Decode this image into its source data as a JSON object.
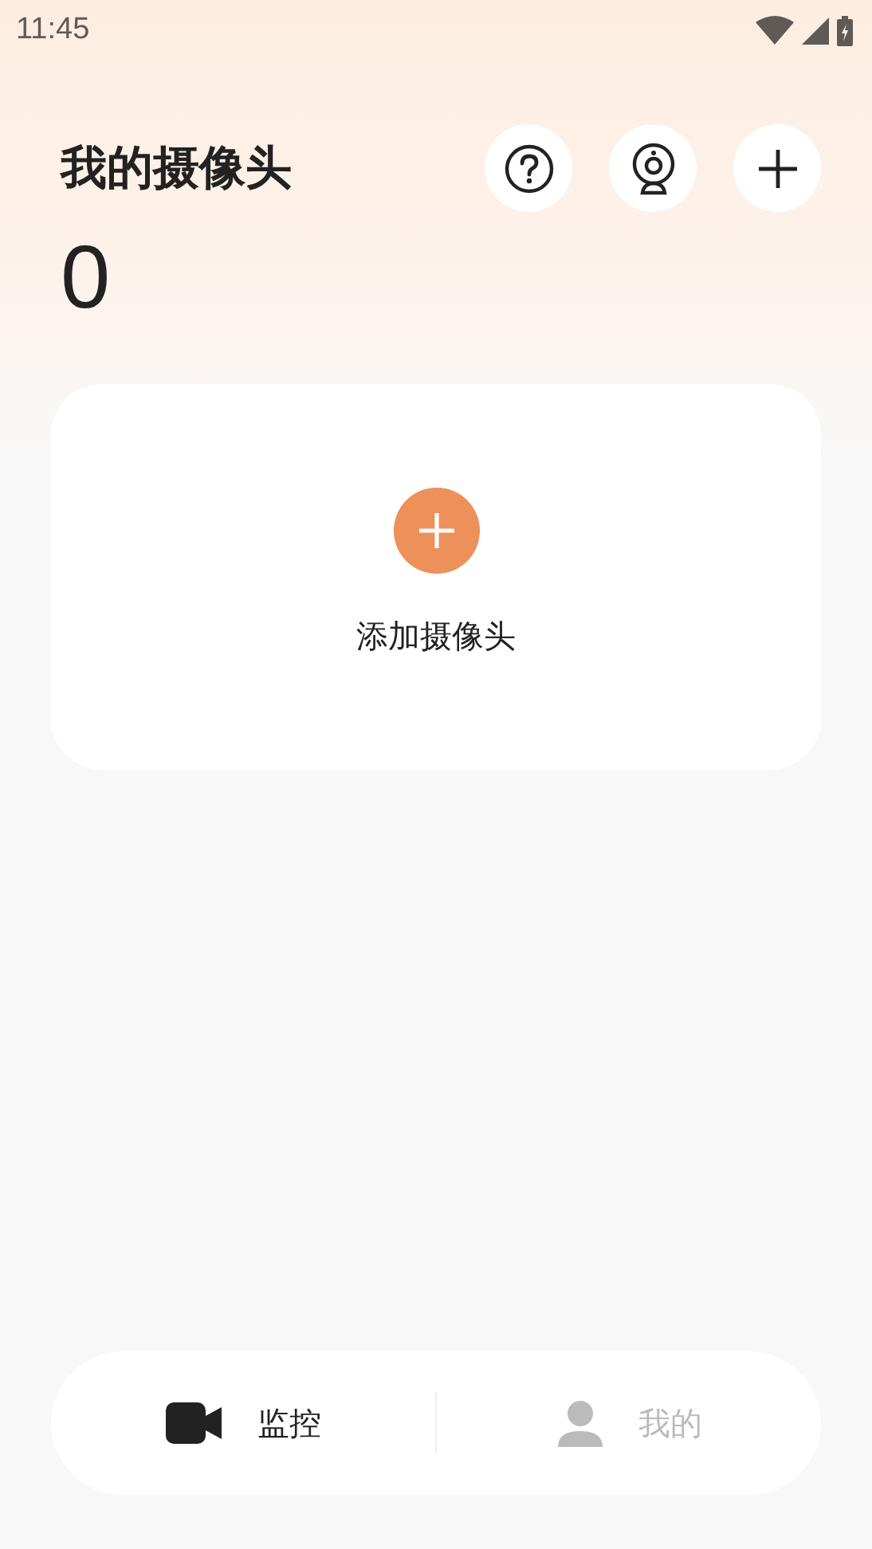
{
  "status_bar": {
    "time": "11:45"
  },
  "header": {
    "title": "我的摄像头",
    "count": "0",
    "actions": [
      {
        "kind": "help"
      },
      {
        "kind": "camera"
      },
      {
        "kind": "add"
      }
    ]
  },
  "add_card": {
    "label": "添加摄像头"
  },
  "bottom_nav": [
    {
      "label": "监控",
      "kind": "camera",
      "selected": true
    },
    {
      "label": "我的",
      "kind": "person",
      "selected": false
    }
  ]
}
